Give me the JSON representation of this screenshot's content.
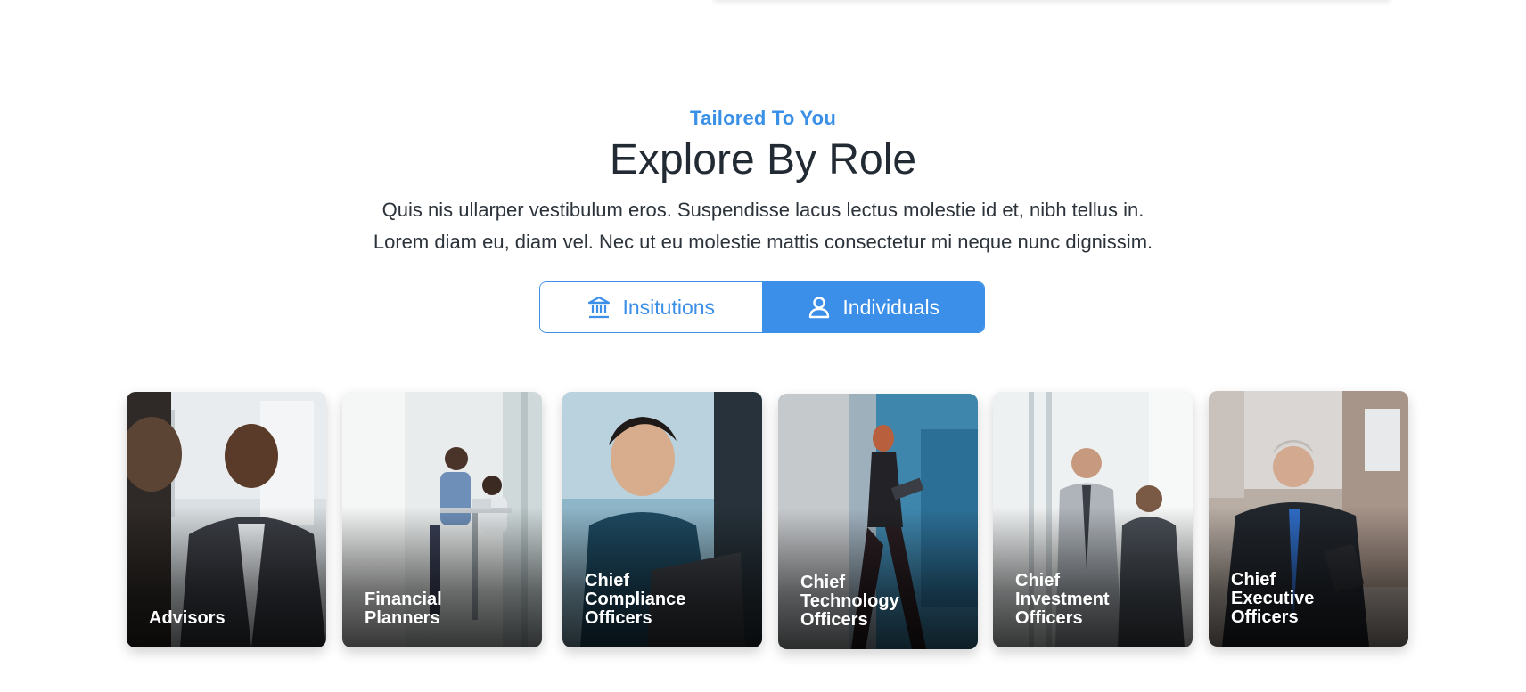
{
  "section": {
    "eyebrow": "Tailored To You",
    "title": "Explore By Role",
    "description_line1": "Quis nis ullarper vestibulum eros. Suspendisse lacus lectus molestie id et, nibh tellus in.",
    "description_line2": "Lorem diam eu, diam vel. Nec ut eu molestie mattis consectetur mi neque nunc dignissim."
  },
  "toggle": {
    "institutions_label": "Insitutions",
    "institutions_icon": "bank-icon",
    "individuals_label": "Individuals",
    "individuals_icon": "person-icon",
    "selected": "Individuals"
  },
  "colors": {
    "accent": "#3b8fe8",
    "eyebrow": "#3a8fe6",
    "text": "#222a33"
  },
  "cards": [
    {
      "lines": [
        "Advisors"
      ]
    },
    {
      "lines": [
        "Financial",
        "Planners"
      ]
    },
    {
      "lines": [
        "Chief",
        "Compliance",
        "Officers"
      ]
    },
    {
      "lines": [
        "Chief",
        "Technology",
        "Officers"
      ]
    },
    {
      "lines": [
        "Chief",
        "Investment",
        "Officers"
      ]
    },
    {
      "lines": [
        "Chief",
        "Executive",
        "Officers"
      ]
    }
  ]
}
